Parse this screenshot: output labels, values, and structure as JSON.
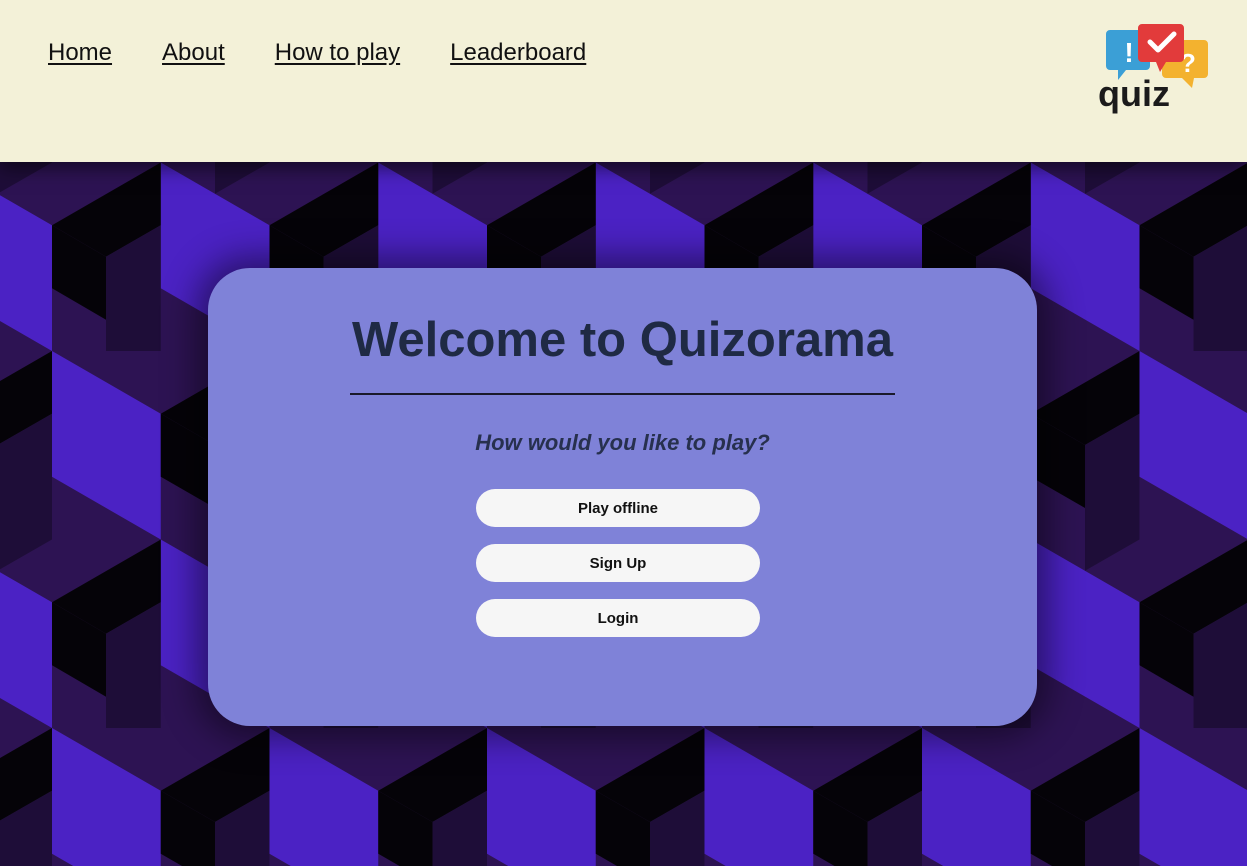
{
  "nav": {
    "links": [
      {
        "label": "Home"
      },
      {
        "label": "About"
      },
      {
        "label": "How to play"
      },
      {
        "label": "Leaderboard"
      }
    ]
  },
  "logo": {
    "text": "quiz",
    "bubble_symbols": [
      "!",
      "✔",
      "?"
    ],
    "colors": {
      "blue": "#3b9fd6",
      "red": "#e23b3b",
      "yellow": "#f3b22f",
      "text": "#1b1b1b"
    }
  },
  "card": {
    "title": "Welcome to Quizorama",
    "subtitle": "How would you like to play?",
    "buttons": {
      "play_offline": "Play offline",
      "sign_up": "Sign Up",
      "login": "Login"
    }
  },
  "theme": {
    "header_bg": "#f3f1d8",
    "card_bg": "#7f82d8",
    "title_color": "#1f2a44",
    "pattern_purple": "#4b22c4",
    "pattern_dark": "#2d1353",
    "pattern_black": "#050308"
  }
}
